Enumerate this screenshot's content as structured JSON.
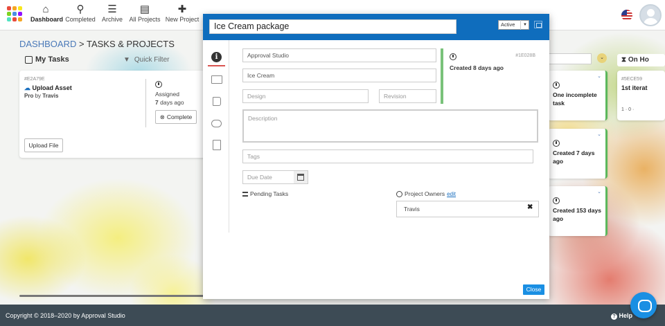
{
  "nav": {
    "items": [
      {
        "label": "Dashboard",
        "icon": "home-icon"
      },
      {
        "label": "Completed",
        "icon": "search-icon"
      },
      {
        "label": "Archive",
        "icon": "database-icon"
      },
      {
        "label": "All Projects",
        "icon": "list-icon"
      },
      {
        "label": "New Project",
        "icon": "plus-icon"
      }
    ]
  },
  "breadcrumb": {
    "home": "DASHBOARD",
    "separator": ">",
    "current": "TASKS & PROJECTS"
  },
  "my_tasks": {
    "label": "My Tasks",
    "filter_placeholder": "Quick Filter"
  },
  "task_card": {
    "id": "#E2A79E",
    "title": "Upload Asset",
    "level": "Pro",
    "by": "by",
    "user": "Travis",
    "assigned_label": "Assigned",
    "assigned_days": "7",
    "assigned_suffix": "days ago",
    "complete_label": "Complete",
    "upload_label": "Upload File"
  },
  "right_cards": [
    {
      "text": "One incomplete task"
    },
    {
      "text": "Created 7 days ago"
    },
    {
      "text": "Created 153 days ago"
    }
  ],
  "on_hold": {
    "label": "On Ho",
    "card_id": "#5ECE59",
    "card_title": "1st iterat",
    "card_counts": "1 · 0 ·"
  },
  "modal": {
    "title": "Ice Cream package",
    "status": "Active",
    "fields": {
      "studio": "Approval Studio",
      "project": "Ice Cream",
      "design_placeholder": "Design",
      "revision_placeholder": "Revision",
      "description_placeholder": "Description",
      "tags_placeholder": "Tags",
      "due_date_placeholder": "Due Date"
    },
    "info": {
      "number": "#1E028B",
      "created": "Created 8 days ago"
    },
    "pending_label": "Pending Tasks",
    "owners_label": "Project Owners",
    "owners_edit": "edit",
    "owner": "Travis",
    "close_label": "Close"
  },
  "footer": {
    "copyright": "Copyright © 2018–2020 by Approval Studio",
    "help": "Help"
  },
  "colors": {
    "header_blue": "#0f6dbd",
    "accent_green": "#79c27a",
    "close_blue": "#1a8fe3",
    "footer": "#3d4b55"
  }
}
